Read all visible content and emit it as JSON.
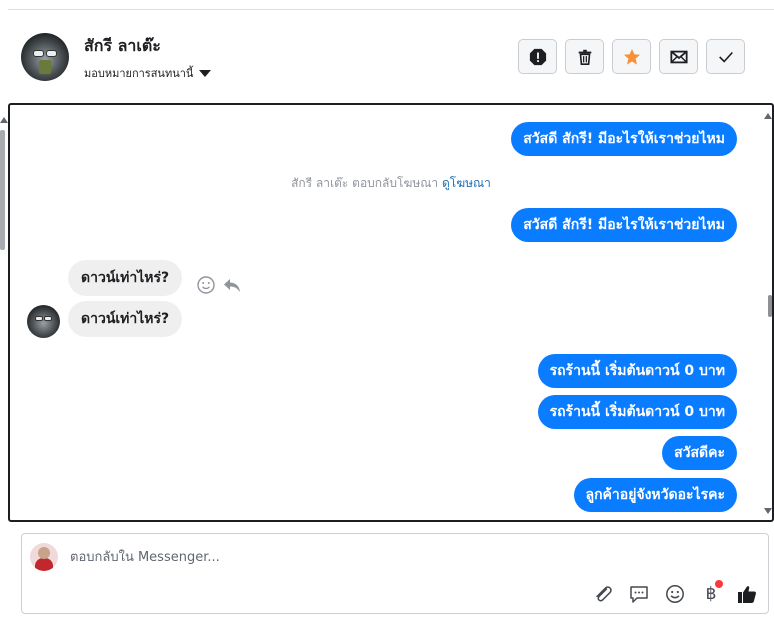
{
  "header": {
    "contact_name": "สักรี ลาเต๊ะ",
    "assign_label": "มอบหมายการสนทนานี้",
    "actions": [
      {
        "name": "spam-button",
        "icon": "alert-icon"
      },
      {
        "name": "delete-button",
        "icon": "trash-icon"
      },
      {
        "name": "follow-up-button",
        "icon": "star-icon",
        "color": "#f7923b"
      },
      {
        "name": "mark-unread-button",
        "icon": "envelope-icon"
      },
      {
        "name": "mark-done-button",
        "icon": "check-icon"
      }
    ]
  },
  "chat": {
    "messages": [
      {
        "direction": "out",
        "text": "สวัสดี สักรี! มีอะไรให้เราช่วยไหม"
      },
      {
        "direction": "system",
        "text": "สักรี ลาเต๊ะ ตอบกลับโฆษณา",
        "link": "ดูโฆษณา"
      },
      {
        "direction": "out",
        "text": "สวัสดี สักรี! มีอะไรให้เราช่วยไหม"
      },
      {
        "direction": "in",
        "text": "ดาวน์เท่าไหร่?"
      },
      {
        "direction": "in",
        "text": "ดาวน์เท่าไหร่?"
      },
      {
        "direction": "out",
        "text": "รถร้านนี้ เริ่มต้นดาวน์ 0 บาท"
      },
      {
        "direction": "out",
        "text": "รถร้านนี้ เริ่มต้นดาวน์ 0 บาท"
      },
      {
        "direction": "out",
        "text": "สวัสดีคะ"
      },
      {
        "direction": "out",
        "text": "ลูกค้าอยู่จังหวัดอะไรคะ"
      }
    ]
  },
  "composer": {
    "placeholder": "ตอบกลับใน Messenger...",
    "value": "",
    "tools": [
      "paperclip-icon",
      "saved-reply-icon",
      "emoji-icon",
      "baht-payment-icon",
      "thumbs-up-icon"
    ],
    "baht_symbol": "฿"
  },
  "colors": {
    "outgoing_bubble": "#0a7cff",
    "incoming_bubble": "#efefef",
    "link": "#1f6fb5",
    "notification_dot": "#fa383e"
  }
}
